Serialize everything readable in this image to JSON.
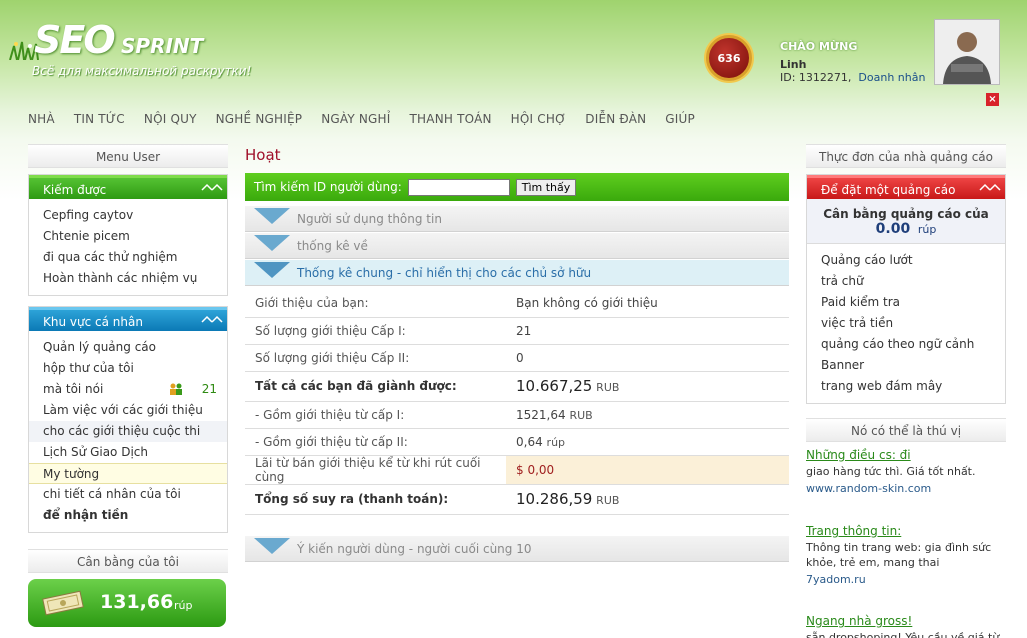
{
  "header": {
    "logo_main": "SEO",
    "logo_sub": "SPRINT",
    "tagline": "Всё для максимальной раскрутки!",
    "rank": "636",
    "greeting": "CHÀO MỪNG",
    "username": "Linh",
    "user_id": "ID: 1312271,",
    "user_status": "Doanh nhân",
    "close_label": "×"
  },
  "nav": [
    "NHÀ",
    "TIN TỨC",
    "NỘI QUY",
    "NGHỀ NGHIỆP",
    "NGÀY NGHỈ",
    "THANH TOÁN",
    "HỘI CHỢ",
    "DIỄN ĐÀN",
    "GIÚP"
  ],
  "left": {
    "menu_title": "Menu User",
    "earn": {
      "title": "Kiếm được",
      "items": [
        "Cepfing caytov",
        "Chtenie picem",
        "đi qua các thử nghiệm",
        "Hoàn thành các nhiệm vụ"
      ]
    },
    "personal": {
      "title": "Khu vực cá nhân",
      "items": [
        "Quản lý quảng cáo",
        "hộp thư của tôi",
        "mà tôi nói",
        "Làm việc với các giới thiệu",
        "cho các giới thiệu cuộc thi",
        "Lịch Sử Giao Dịch",
        "My tường",
        "chi tiết cá nhân của tôi",
        "để nhận tiền"
      ],
      "talk_count": "21"
    },
    "balance_title": "Cân bằng của tôi",
    "balance_amount": "131,66",
    "balance_currency": "rúp"
  },
  "main": {
    "title": "Hoạt",
    "search_label": "Tìm kiếm ID người dùng:",
    "search_value": "",
    "search_button": "Tìm thấy",
    "sections": {
      "user_info": "Người sử dụng thông tin",
      "stats": "thống kê về",
      "general": "Thống kê chung - chỉ hiển thị cho các chủ sở hữu",
      "reviews": "Ý kiến người dùng - người cuối cùng 10"
    },
    "rows": [
      {
        "k": "Giới thiệu của bạn:",
        "v": "Bạn không có giới thiệu",
        "u": ""
      },
      {
        "k": "Số lượng giới thiệu Cấp I:",
        "v": "21",
        "u": ""
      },
      {
        "k": "Số lượng giới thiệu Cấp II:",
        "v": "0",
        "u": ""
      },
      {
        "k": "Tất cả các bạn đã giành được:",
        "v": "10.667,25",
        "u": "RUB"
      },
      {
        "k": "- Gồm giới thiệu từ cấp I:",
        "v": "1521,64",
        "u": "RUB"
      },
      {
        "k": "- Gồm giới thiệu từ cấp II:",
        "v": "0,64",
        "u": "rúp"
      },
      {
        "k": "Lãi từ bán giới thiệu kể từ khi rút cuối cùng",
        "v": "$ 0,00",
        "u": ""
      },
      {
        "k": "Tổng số suy ra (thanh toán):",
        "v": "10.286,59",
        "u": "RUB"
      }
    ]
  },
  "right": {
    "menu_title": "Thực đơn của nhà quảng cáo",
    "box_title": "Để đặt một quảng cáo",
    "ads_balance_title": "Cân bằng quảng cáo của",
    "ads_balance_amount": "0.00",
    "ads_balance_currency": "rúp",
    "items": [
      "Quảng cáo lướt",
      "trả chữ",
      "Paid kiểm tra",
      "việc trả tiền",
      "quảng cáo theo ngữ cảnh",
      "Banner",
      "trang web đám mây"
    ],
    "interest_title": "Nó có thể là thú vị",
    "promos": [
      {
        "title": "Những điều cs: đi",
        "desc": "giao hàng tức thì. Giá tốt nhất.",
        "url": "www.random-skin.com"
      },
      {
        "title": "Trang thông tin:",
        "desc": "Thông tin trang web: gia đình sức khỏe, trẻ em, mang thai",
        "url": "7yadom.ru"
      },
      {
        "title": "Ngang nhà gross!",
        "desc": "sẵn dropshoping! Yêu cầu về giá từ các",
        "url": ""
      }
    ]
  },
  "colors": {
    "green": "#3aa90c",
    "blue": "#0b79b5",
    "red": "#c81818",
    "title": "#a0102a"
  }
}
